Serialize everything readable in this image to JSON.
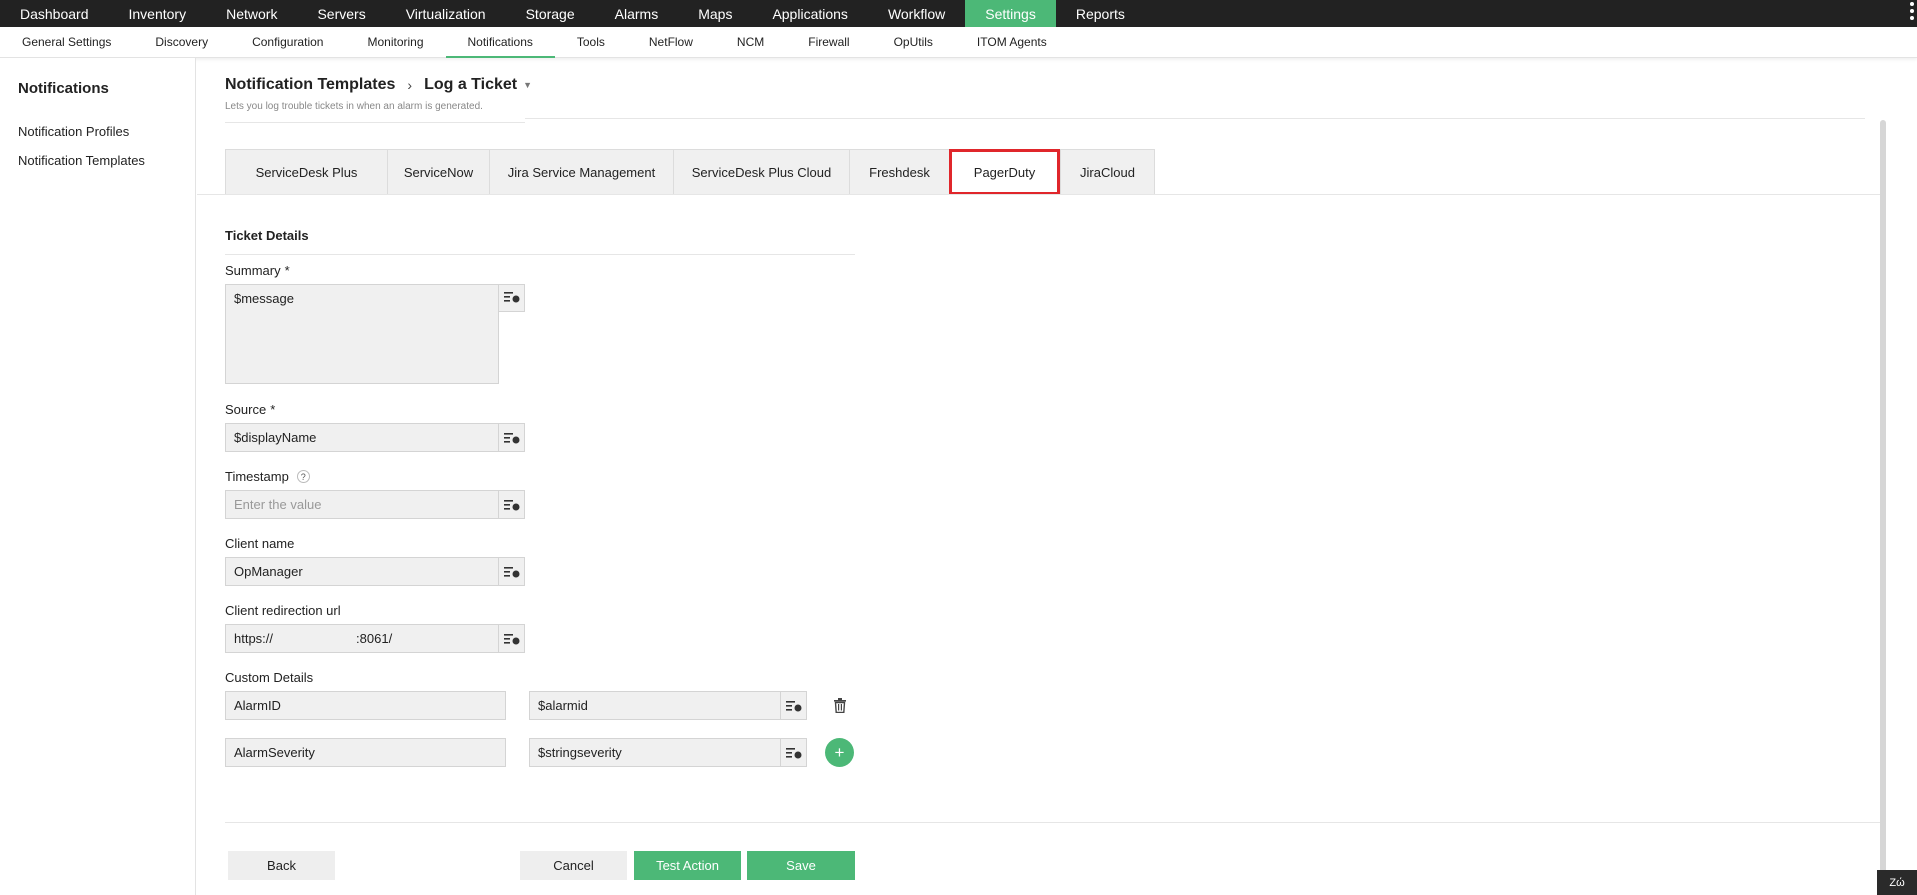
{
  "topnav": {
    "items": [
      "Dashboard",
      "Inventory",
      "Network",
      "Servers",
      "Virtualization",
      "Storage",
      "Alarms",
      "Maps",
      "Applications",
      "Workflow",
      "Settings",
      "Reports"
    ],
    "active": "Settings"
  },
  "subnav": {
    "items": [
      "General Settings",
      "Discovery",
      "Configuration",
      "Monitoring",
      "Notifications",
      "Tools",
      "NetFlow",
      "NCM",
      "Firewall",
      "OpUtils",
      "ITOM Agents"
    ],
    "active": "Notifications"
  },
  "sidebar": {
    "title": "Notifications",
    "links": [
      "Notification Profiles",
      "Notification Templates"
    ]
  },
  "header": {
    "breadcrumb_parent": "Notification Templates",
    "breadcrumb_current": "Log a Ticket",
    "description": "Lets you log trouble tickets in when an alarm is generated."
  },
  "tabs": {
    "items": [
      "ServiceDesk Plus",
      "ServiceNow",
      "Jira Service Management",
      "ServiceDesk Plus Cloud",
      "Freshdesk",
      "PagerDuty",
      "JiraCloud"
    ],
    "selected": "PagerDuty"
  },
  "form": {
    "section_title": "Ticket Details",
    "summary_label": "Summary",
    "summary_value": "$message",
    "source_label": "Source",
    "source_value": "$displayName",
    "required_mark": "*",
    "timestamp_label": "Timestamp",
    "timestamp_help": "?",
    "timestamp_placeholder": "Enter the value",
    "client_name_label": "Client name",
    "client_name_value": "OpManager",
    "client_url_label": "Client redirection url",
    "client_url_prefix": "https://",
    "client_url_suffix": ":8061/",
    "custom_label": "Custom Details",
    "custom_rows": [
      {
        "key": "AlarmID",
        "value": "$alarmid"
      },
      {
        "key": "AlarmSeverity",
        "value": "$stringseverity"
      }
    ],
    "add_symbol": "+"
  },
  "actions": {
    "back": "Back",
    "cancel": "Cancel",
    "test": "Test Action",
    "save": "Save"
  },
  "corner": "Ζώ",
  "colors": {
    "topbar": "#222222",
    "accent": "#4cb877",
    "highlight": "#e0262b"
  }
}
